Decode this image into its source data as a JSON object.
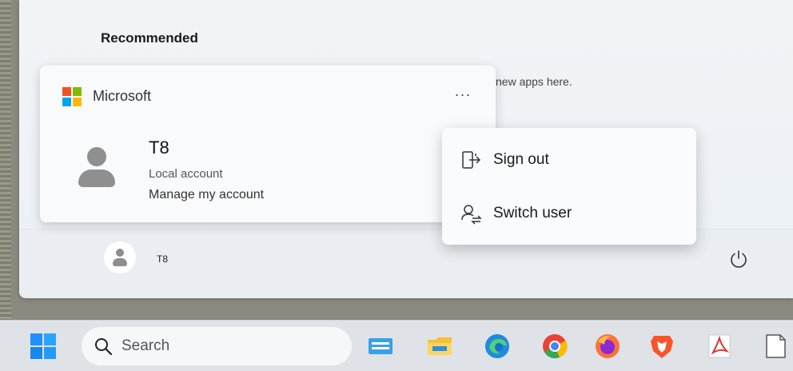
{
  "start_menu": {
    "recommended_title": "Recommended",
    "recommended_hint": "new apps here."
  },
  "account_card": {
    "provider": "Microsoft",
    "more_label": "···",
    "user_name": "T8",
    "account_type": "Local account",
    "manage_label": "Manage my account"
  },
  "context_menu": {
    "items": [
      {
        "label": "Sign out",
        "icon": "sign-out-icon"
      },
      {
        "label": "Switch user",
        "icon": "switch-user-icon"
      }
    ]
  },
  "footer": {
    "user_name": "T8",
    "power_icon": "power-icon"
  },
  "taskbar": {
    "search_label": "Search",
    "apps": [
      "start-icon",
      "keyboard-app-icon",
      "file-explorer-icon",
      "edge-icon",
      "chrome-icon",
      "firefox-icon",
      "brave-icon",
      "pdf-reader-icon",
      "notepad-icon"
    ]
  },
  "colors": {
    "ms_red": "#f25022",
    "ms_green": "#7fba00",
    "ms_blue": "#00a4ef",
    "ms_yellow": "#ffb900"
  }
}
